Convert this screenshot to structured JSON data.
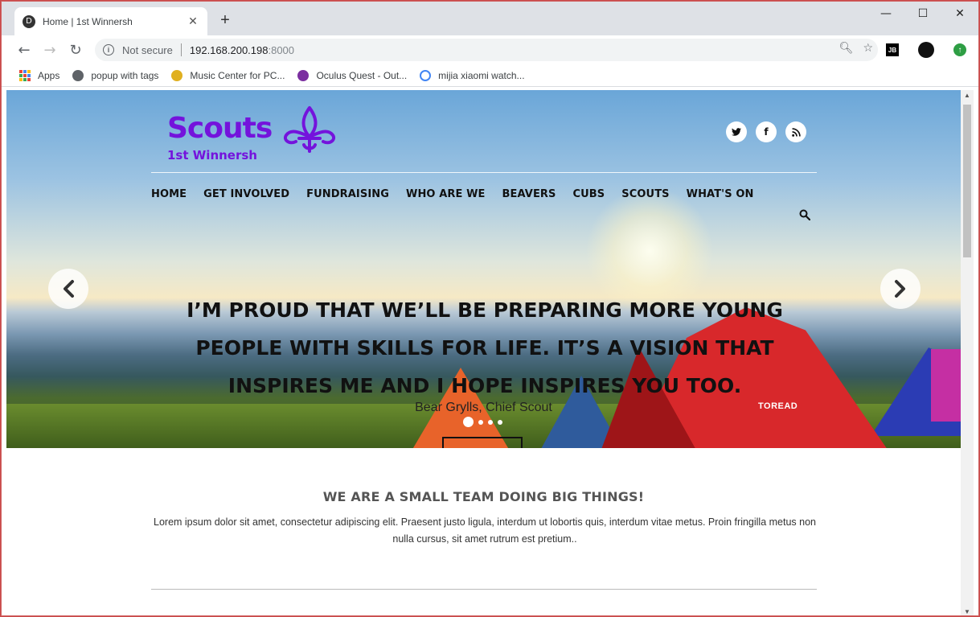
{
  "browser": {
    "tab_title": "Home | 1st Winnersh",
    "tab_favicon": "D",
    "new_tab": "+",
    "close_tab": "✕",
    "window_controls": [
      "—",
      "☐",
      "✕"
    ],
    "not_secure": "Not secure",
    "url_host": "192.168.200.198",
    "url_port": ":8000",
    "ext_jb": "JB"
  },
  "bookmarks": [
    {
      "label": "Apps",
      "icon": "apps-grid-icon"
    },
    {
      "label": "popup with tags",
      "icon": "globe-icon",
      "color": "#5f6368"
    },
    {
      "label": "Music Center for PC...",
      "icon": "music-icon",
      "color": "#e0b020"
    },
    {
      "label": "Oculus Quest - Out...",
      "icon": "oculus-icon",
      "color": "#7b2fa0"
    },
    {
      "label": "mijia xiaomi watch...",
      "icon": "google-icon",
      "color": "#4285f4"
    }
  ],
  "site": {
    "logo_word": "Scouts",
    "logo_sub": "1st Winnersh",
    "brand_color": "#7413dc",
    "social": [
      {
        "label": "🐦",
        "name": "twitter-icon"
      },
      {
        "label": "f",
        "name": "facebook-icon"
      },
      {
        "label": "◉",
        "name": "rss-icon"
      }
    ],
    "nav": [
      "HOME",
      "GET INVOLVED",
      "FUNDRAISING",
      "WHO ARE WE",
      "BEAVERS",
      "CUBS",
      "SCOUTS",
      "WHAT'S ON"
    ],
    "hero": {
      "quote": "I’M PROUD THAT WE’LL BE PREPARING MORE YOUNG PEOPLE WITH SKILLS FOR LIFE. IT’S A VISION THAT INSPIRES ME AND I HOPE INSPIRES YOU TOO.",
      "author": "Bear Grylls, Chief Scout",
      "tent_brand": "TOREAD",
      "slide_count": 4,
      "active_slide": 1
    },
    "intro": {
      "title": "WE ARE A SMALL TEAM DOING BIG THINGS!",
      "text": "Lorem ipsum dolor sit amet, consectetur adipiscing elit. Praesent justo ligula, interdum ut lobortis quis, interdum vitae metus. Proin fringilla metus non nulla cursus, sit amet rutrum est pretium.."
    }
  }
}
